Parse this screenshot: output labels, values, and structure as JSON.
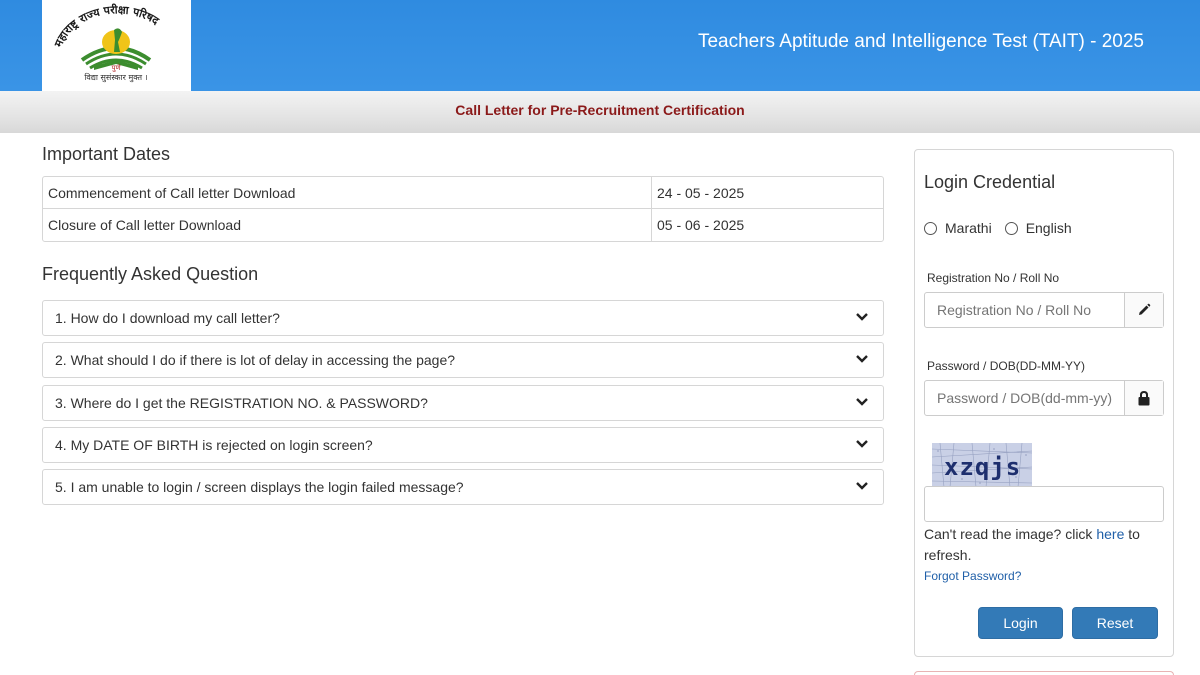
{
  "header": {
    "title": "Teachers Aptitude and Intelligence Test (TAIT) - 2025",
    "logo_icon": "maharashtra-pariksha-parishad-logo",
    "logo_top_text": "महाराष्ट्र राज्य परीक्षा परिषद",
    "logo_city": "पुणे",
    "logo_motto": "विद्या सुसंस्कार मुक्त ।",
    "background_color": "#3a94e6"
  },
  "subheader": {
    "text": "Call Letter for Pre-Recruitment Certification",
    "color": "#8b1a1a"
  },
  "important_dates": {
    "title": "Important Dates",
    "rows": [
      {
        "label": "Commencement of Call letter Download",
        "value": "24 - 05 - 2025"
      },
      {
        "label": "Closure of Call letter Download",
        "value": "05 - 06 - 2025"
      }
    ]
  },
  "faq": {
    "title": "Frequently Asked Question",
    "items": [
      {
        "question": "1. How do I download my call letter?",
        "icon": "chevron-down-icon"
      },
      {
        "question": "2. What should I do if there is lot of delay in accessing the page?",
        "icon": "chevron-down-icon"
      },
      {
        "question": "3. Where do I get the REGISTRATION NO. & PASSWORD?",
        "icon": "chevron-down-icon"
      },
      {
        "question": "4. My DATE OF BIRTH is rejected on login screen?",
        "icon": "chevron-down-icon"
      },
      {
        "question": "5. I am unable to login / screen displays the login failed message?",
        "icon": "chevron-down-icon"
      }
    ]
  },
  "login": {
    "title": "Login Credential",
    "languages": [
      "Marathi",
      "English"
    ],
    "selected_language": "",
    "registration_label": "Registration No / Roll No",
    "registration_placeholder": "Registration No / Roll No",
    "registration_value": "",
    "registration_icon": "pencil-icon",
    "password_label": "Password / DOB(DD-MM-YY)",
    "password_placeholder": "Password / DOB(dd-mm-yy)",
    "password_value": "",
    "password_icon": "lock-icon",
    "captcha_text": "xzqjs",
    "captcha_value": "",
    "help_prefix": "Can't read the image? click ",
    "help_link": "here",
    "help_suffix": " to refresh.",
    "forgot_password": "Forgot Password?",
    "login_button": "Login",
    "reset_button": "Reset",
    "button_color": "#337ab7",
    "link_color": "#1f5fa8"
  }
}
